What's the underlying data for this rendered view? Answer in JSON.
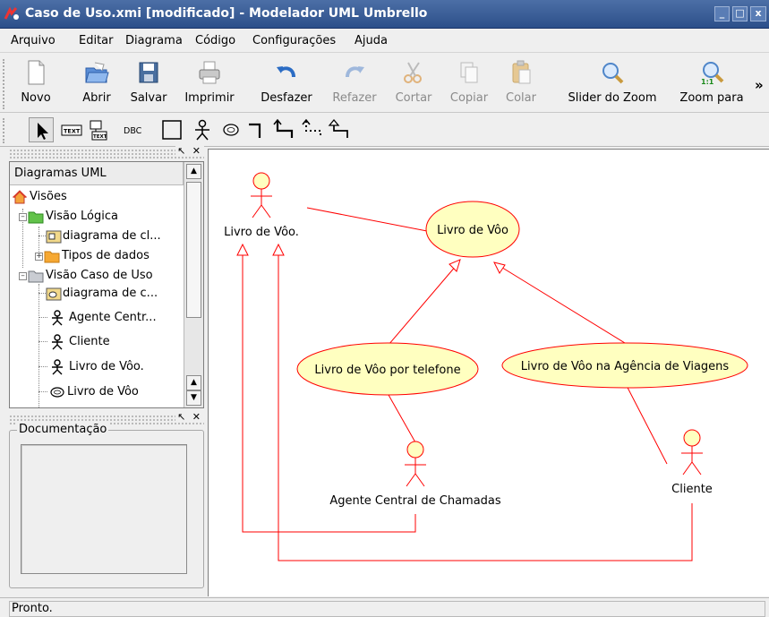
{
  "window": {
    "title": "Caso de Uso.xmi [modificado] - Modelador UML Umbrello",
    "controls": [
      "_",
      "□",
      "x"
    ]
  },
  "menubar": [
    {
      "label": "Arquivo"
    },
    {
      "label": "Editar"
    },
    {
      "label": "Diagrama"
    },
    {
      "label": "Código"
    },
    {
      "label": "Configurações"
    },
    {
      "label": "Ajuda"
    }
  ],
  "toolbar": {
    "buttons": [
      {
        "label": "Novo",
        "icon": "new-document-icon",
        "enabled": true
      },
      {
        "label": "Abrir",
        "icon": "open-folder-icon",
        "enabled": true
      },
      {
        "label": "Salvar",
        "icon": "save-disk-icon",
        "enabled": true
      },
      {
        "label": "Imprimir",
        "icon": "printer-icon",
        "enabled": true
      },
      {
        "label": "Desfazer",
        "icon": "undo-icon",
        "enabled": true
      },
      {
        "label": "Refazer",
        "icon": "redo-icon",
        "enabled": false
      },
      {
        "label": "Cortar",
        "icon": "scissors-icon",
        "enabled": false
      },
      {
        "label": "Copiar",
        "icon": "copy-icon",
        "enabled": false
      },
      {
        "label": "Colar",
        "icon": "paste-icon",
        "enabled": false
      },
      {
        "label": "Slider do Zoom",
        "icon": "zoom-icon",
        "enabled": true
      },
      {
        "label": "Zoom para",
        "icon": "zoom-1-1-icon",
        "enabled": true
      }
    ],
    "more": "»"
  },
  "diagram_toolbar": {
    "tools": [
      "select-arrow-icon",
      "text-tool-icon",
      "note-tool-icon",
      "dbc-tool-icon",
      "box-tool-icon",
      "actor-tool-icon",
      "usecase-tool-icon",
      "association-tool-icon",
      "generalization-tool-icon",
      "dependency-tool-icon",
      "realization-tool-icon"
    ],
    "dbc_label": "DBC",
    "text_label": "TEXT"
  },
  "tree_panel": {
    "header": "Diagramas UML",
    "dock_controls": "↖ ✕",
    "items": [
      {
        "label": "Visões"
      },
      {
        "label": "Visão Lógica"
      },
      {
        "label": "diagrama de cl..."
      },
      {
        "label": "Tipos de dados"
      },
      {
        "label": "Visão Caso de Uso"
      },
      {
        "label": "diagrama de c..."
      },
      {
        "label": "Agente Centr..."
      },
      {
        "label": "Cliente"
      },
      {
        "label": "Livro de Vôo."
      },
      {
        "label": "Livro de Vôo"
      }
    ]
  },
  "doc_panel": {
    "legend": "Documentação",
    "dock_controls": "↖ ✕"
  },
  "diagram": {
    "actors": [
      {
        "name": "Livro de Vôo."
      },
      {
        "name": "Agente Central de Chamadas"
      },
      {
        "name": "Cliente"
      }
    ],
    "usecases": [
      {
        "name": "Livro de Vôo"
      },
      {
        "name": "Livro de Vôo por telefone"
      },
      {
        "name": "Livro de Vôo na Agência de Viagens"
      }
    ],
    "colors": {
      "line": "#ff0000",
      "fill": "#ffffc0",
      "stroke": "#ff0000"
    }
  },
  "status": "Pronto."
}
